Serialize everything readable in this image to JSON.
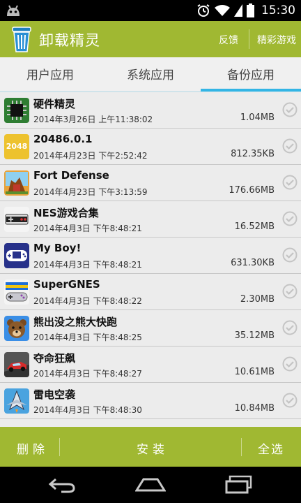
{
  "status_bar": {
    "time": "15:30"
  },
  "action_bar": {
    "title": "卸载精灵",
    "feedback_label": "反馈",
    "games_label": "精彩游戏"
  },
  "tabs": [
    {
      "label": "用户应用",
      "selected": false
    },
    {
      "label": "系统应用",
      "selected": false
    },
    {
      "label": "备份应用",
      "selected": true
    }
  ],
  "apps": [
    {
      "name": "硬件精灵",
      "date": "2014年3月26日 上午11:38:02",
      "size": "1.04MB",
      "icon": "chip-icon"
    },
    {
      "name": "20486.0.1",
      "date": "2014年4月23日 下午2:52:42",
      "size": "812.35KB",
      "icon": "2048-icon",
      "icon_text": "2048"
    },
    {
      "name": "Fort Defense",
      "date": "2014年4月23日 下午3:13:59",
      "size": "176.66MB",
      "icon": "fort-defense-icon"
    },
    {
      "name": "NES游戏合集",
      "date": "2014年4月3日 下午8:48:21",
      "size": "16.52MB",
      "icon": "nes-controller-icon"
    },
    {
      "name": "My Boy!",
      "date": "2014年4月3日 下午8:48:21",
      "size": "631.30KB",
      "icon": "gba-icon"
    },
    {
      "name": "SuperGNES",
      "date": "2014年4月3日 下午8:48:22",
      "size": "2.30MB",
      "icon": "snes-controller-icon"
    },
    {
      "name": "熊出没之熊大快跑",
      "date": "2014年4月3日 下午8:48:25",
      "size": "35.12MB",
      "icon": "bear-icon"
    },
    {
      "name": "夺命狂飙",
      "date": "2014年4月3日 下午8:48:27",
      "size": "10.61MB",
      "icon": "race-car-icon"
    },
    {
      "name": "雷电空袭",
      "date": "2014年4月3日 下午8:48:30",
      "size": "10.84MB",
      "icon": "jet-icon"
    }
  ],
  "bottom_bar": {
    "delete_label": "删除",
    "install_label": "安装",
    "select_all_label": "全选"
  },
  "colors": {
    "accent": "#a0b832",
    "tab_indicator": "#33b5e5"
  }
}
